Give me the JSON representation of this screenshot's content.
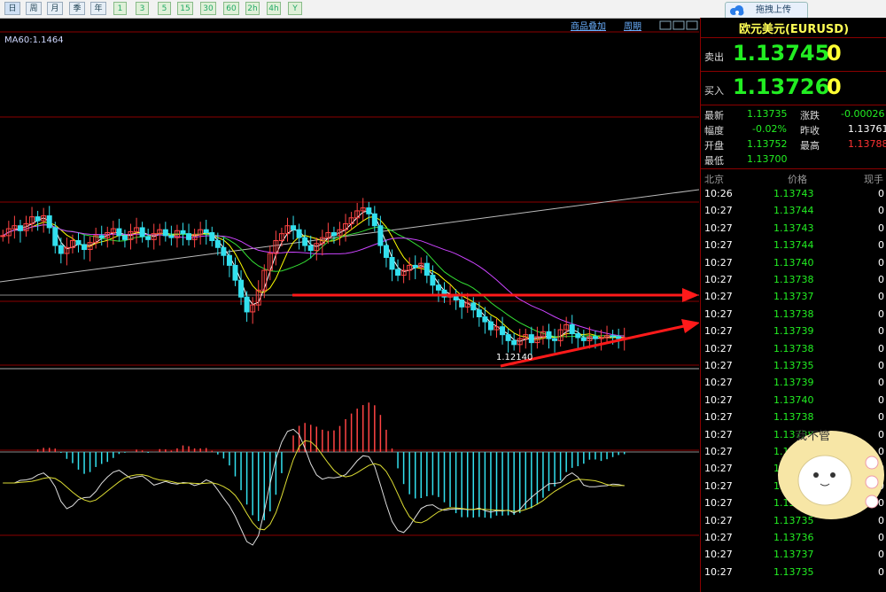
{
  "toolbar": {
    "buttons": [
      {
        "label": "日",
        "kind": "sel"
      },
      {
        "label": "周",
        "kind": ""
      },
      {
        "label": "月",
        "kind": ""
      },
      {
        "label": "季",
        "kind": ""
      },
      {
        "label": "年",
        "kind": ""
      },
      {
        "label": "1",
        "kind": "green"
      },
      {
        "label": "3",
        "kind": "green"
      },
      {
        "label": "5",
        "kind": "green"
      },
      {
        "label": "15",
        "kind": "green"
      },
      {
        "label": "30",
        "kind": "green"
      },
      {
        "label": "60",
        "kind": "green"
      },
      {
        "label": "2h",
        "kind": "green"
      },
      {
        "label": "4h",
        "kind": "green"
      },
      {
        "label": "Y",
        "kind": "green"
      }
    ],
    "cloud_button_label": "拖拽上传"
  },
  "chart_menu": {
    "overlay": "商品叠加",
    "period": "周期"
  },
  "chart": {
    "ma_label": "MA60:1.1464",
    "low_label": "1.12140"
  },
  "quote": {
    "pair": "欧元美元(EURUSD)",
    "sell_label": "卖出",
    "sell_value": "1.13745",
    "sell_tail": "0",
    "buy_label": "买入",
    "buy_value": "1.13726",
    "buy_tail": "0"
  },
  "stats": {
    "latest_label": "最新",
    "latest": "1.13735",
    "change_label": "涨跌",
    "change": "-0.00026",
    "range_label": "幅度",
    "range": "-0.02%",
    "prevclose_label": "昨收",
    "prevclose": "1.13761",
    "open_label": "开盘",
    "open": "1.13752",
    "high_label": "最高",
    "high": "1.13788",
    "low_label": "最低",
    "low": "1.13700"
  },
  "ticks_header": {
    "time": "北京",
    "price": "价格",
    "vol": "现手"
  },
  "ticks": [
    {
      "time": "10:26",
      "price": "1.13743",
      "vol": "0"
    },
    {
      "time": "10:27",
      "price": "1.13744",
      "vol": "0"
    },
    {
      "time": "10:27",
      "price": "1.13743",
      "vol": "0"
    },
    {
      "time": "10:27",
      "price": "1.13744",
      "vol": "0"
    },
    {
      "time": "10:27",
      "price": "1.13740",
      "vol": "0"
    },
    {
      "time": "10:27",
      "price": "1.13738",
      "vol": "0"
    },
    {
      "time": "10:27",
      "price": "1.13737",
      "vol": "0"
    },
    {
      "time": "10:27",
      "price": "1.13738",
      "vol": "0"
    },
    {
      "time": "10:27",
      "price": "1.13739",
      "vol": "0"
    },
    {
      "time": "10:27",
      "price": "1.13738",
      "vol": "0"
    },
    {
      "time": "10:27",
      "price": "1.13735",
      "vol": "0"
    },
    {
      "time": "10:27",
      "price": "1.13739",
      "vol": "0"
    },
    {
      "time": "10:27",
      "price": "1.13740",
      "vol": "0"
    },
    {
      "time": "10:27",
      "price": "1.13738",
      "vol": "0"
    },
    {
      "time": "10:27",
      "price": "1.13738",
      "vol": "0"
    },
    {
      "time": "10:27",
      "price": "1.13738",
      "vol": "0"
    },
    {
      "time": "10:27",
      "price": "1.13735",
      "vol": "0"
    },
    {
      "time": "10:27",
      "price": "1.13735",
      "vol": "0"
    },
    {
      "time": "10:27",
      "price": "1.13735",
      "vol": "0"
    },
    {
      "time": "10:27",
      "price": "1.13735",
      "vol": "0"
    },
    {
      "time": "10:27",
      "price": "1.13736",
      "vol": "0"
    },
    {
      "time": "10:27",
      "price": "1.13737",
      "vol": "0"
    },
    {
      "time": "10:27",
      "price": "1.13735",
      "vol": "0"
    }
  ],
  "sticker": {
    "text": "我不管"
  },
  "colors": {
    "up": "#ff4444",
    "down": "#33e0ee",
    "grid": "#8b0000",
    "arrow": "#ff1a1a"
  },
  "chart_data": {
    "type": "candlestick",
    "indicator_label": "MA60:1.1464",
    "low_annotation": "1.12140",
    "close": [
      1.148,
      1.1487,
      1.149,
      1.1485,
      1.1492,
      1.1499,
      1.1495,
      1.15,
      1.1488,
      1.147,
      1.1462,
      1.1468,
      1.1475,
      1.1471,
      1.1466,
      1.1473,
      1.148,
      1.1478,
      1.1483,
      1.1487,
      1.148,
      1.1476,
      1.1484,
      1.1488,
      1.1479,
      1.1476,
      1.1482,
      1.1486,
      1.148,
      1.1478,
      1.1485,
      1.1482,
      1.1476,
      1.1481,
      1.1486,
      1.1483,
      1.1475,
      1.1468,
      1.146,
      1.145,
      1.1435,
      1.1418,
      1.1403,
      1.141,
      1.1425,
      1.1445,
      1.1462,
      1.1475,
      1.1482,
      1.149,
      1.1486,
      1.1478,
      1.147,
      1.1465,
      1.1472,
      1.1478,
      1.1483,
      1.148,
      1.1486,
      1.1492,
      1.1498,
      1.1505,
      1.1508,
      1.1502,
      1.149,
      1.147,
      1.1458,
      1.1446,
      1.144,
      1.1445,
      1.145,
      1.1448,
      1.1452,
      1.144,
      1.143,
      1.1425,
      1.1418,
      1.142,
      1.1415,
      1.1408,
      1.1412,
      1.1405,
      1.1398,
      1.1393,
      1.1385,
      1.1388,
      1.138,
      1.1374,
      1.137,
      1.1376,
      1.138,
      1.1372,
      1.1378,
      1.1383,
      1.1376,
      1.1374,
      1.1385,
      1.139,
      1.1381,
      1.1377,
      1.1374,
      1.1378,
      1.1376,
      1.1377,
      1.1379,
      1.1378,
      1.1376,
      1.1377
    ]
  }
}
